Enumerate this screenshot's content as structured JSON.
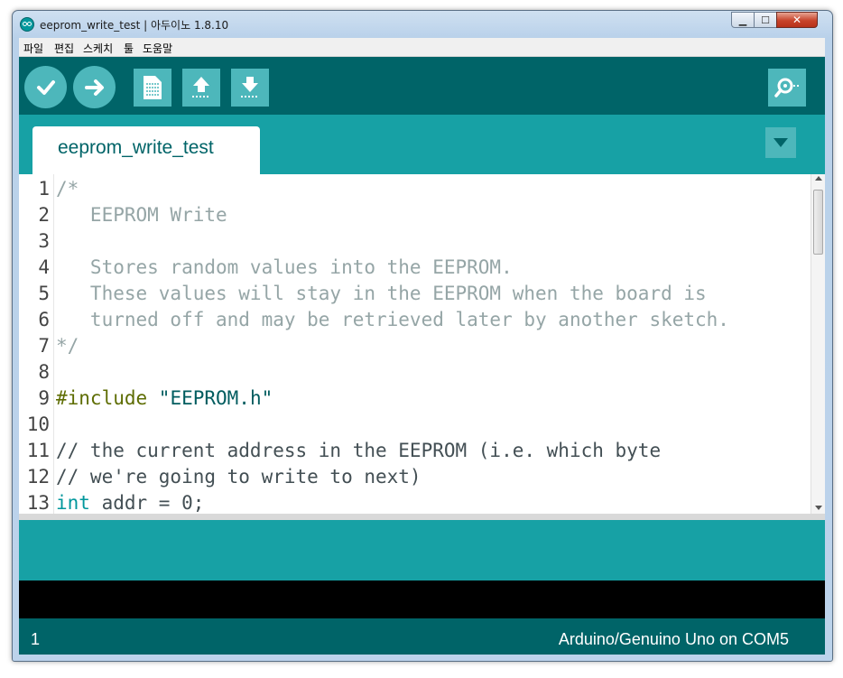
{
  "window": {
    "title": "eeprom_write_test | 아두이노 1.8.10",
    "minimize_glyph": "▁",
    "maximize_glyph": "☐",
    "close_glyph": "✕"
  },
  "menu": [
    "파일",
    "편집",
    "스케치",
    "툴",
    "도움말"
  ],
  "toolbar": {
    "buttons": [
      "verify-icon",
      "upload-icon",
      "new-icon",
      "open-icon",
      "save-icon"
    ],
    "serial_monitor": "serial-monitor-icon"
  },
  "tabs": [
    {
      "label": "eeprom_write_test",
      "active": true
    }
  ],
  "editor": {
    "lines": [
      {
        "n": "1",
        "segments": [
          {
            "t": "/*",
            "c": "cmt"
          }
        ]
      },
      {
        "n": "2",
        "segments": [
          {
            "t": "   EEPROM Write",
            "c": "cmt"
          }
        ]
      },
      {
        "n": "3",
        "segments": [
          {
            "t": "",
            "c": "cmt"
          }
        ]
      },
      {
        "n": "4",
        "segments": [
          {
            "t": "   Stores random values into the EEPROM.",
            "c": "cmt"
          }
        ]
      },
      {
        "n": "5",
        "segments": [
          {
            "t": "   These values will stay in the EEPROM when the board is",
            "c": "cmt"
          }
        ]
      },
      {
        "n": "6",
        "segments": [
          {
            "t": "   turned off and may be retrieved later by another sketch.",
            "c": "cmt"
          }
        ]
      },
      {
        "n": "7",
        "segments": [
          {
            "t": "*/",
            "c": "cmt"
          }
        ]
      },
      {
        "n": "8",
        "segments": [
          {
            "t": "",
            "c": "plain"
          }
        ]
      },
      {
        "n": "9",
        "segments": [
          {
            "t": "#include ",
            "c": "pre"
          },
          {
            "t": "\"EEPROM.h\"",
            "c": "str"
          }
        ]
      },
      {
        "n": "10",
        "segments": [
          {
            "t": "",
            "c": "plain"
          }
        ]
      },
      {
        "n": "11",
        "segments": [
          {
            "t": "// the current address in the EEPROM (i.e. which byte",
            "c": "plain"
          }
        ]
      },
      {
        "n": "12",
        "segments": [
          {
            "t": "// we're going to write to next)",
            "c": "plain"
          }
        ]
      },
      {
        "n": "13",
        "segments": [
          {
            "t": "int",
            "c": "kw"
          },
          {
            "t": " addr = 0;",
            "c": "plain"
          }
        ]
      }
    ]
  },
  "status": {
    "line": "1",
    "board": "Arduino/Genuino Uno on COM5"
  },
  "colors": {
    "toolbar": "#006468",
    "tabbar": "#17a1a5",
    "button": "#4db7bb",
    "console": "#000000"
  }
}
